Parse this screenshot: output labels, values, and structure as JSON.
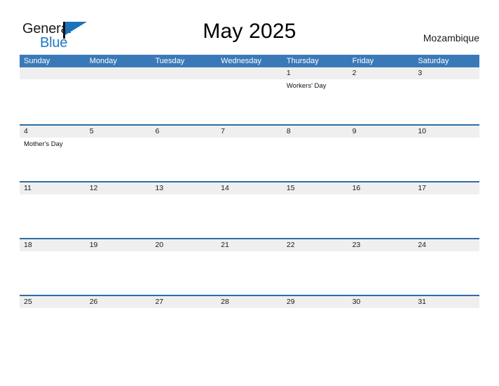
{
  "brand": {
    "name_part1": "General",
    "name_part2": "Blue",
    "flag_icon": "blue-flag-icon"
  },
  "header": {
    "title": "May 2025",
    "country": "Mozambique"
  },
  "calendar": {
    "weekdays": [
      "Sunday",
      "Monday",
      "Tuesday",
      "Wednesday",
      "Thursday",
      "Friday",
      "Saturday"
    ],
    "weeks": [
      {
        "days": [
          {
            "num": "",
            "events": []
          },
          {
            "num": "",
            "events": []
          },
          {
            "num": "",
            "events": []
          },
          {
            "num": "",
            "events": []
          },
          {
            "num": "1",
            "events": [
              "Workers' Day"
            ]
          },
          {
            "num": "2",
            "events": []
          },
          {
            "num": "3",
            "events": []
          }
        ]
      },
      {
        "days": [
          {
            "num": "4",
            "events": [
              "Mother's Day"
            ]
          },
          {
            "num": "5",
            "events": []
          },
          {
            "num": "6",
            "events": []
          },
          {
            "num": "7",
            "events": []
          },
          {
            "num": "8",
            "events": []
          },
          {
            "num": "9",
            "events": []
          },
          {
            "num": "10",
            "events": []
          }
        ]
      },
      {
        "days": [
          {
            "num": "11",
            "events": []
          },
          {
            "num": "12",
            "events": []
          },
          {
            "num": "13",
            "events": []
          },
          {
            "num": "14",
            "events": []
          },
          {
            "num": "15",
            "events": []
          },
          {
            "num": "16",
            "events": []
          },
          {
            "num": "17",
            "events": []
          }
        ]
      },
      {
        "days": [
          {
            "num": "18",
            "events": []
          },
          {
            "num": "19",
            "events": []
          },
          {
            "num": "20",
            "events": []
          },
          {
            "num": "21",
            "events": []
          },
          {
            "num": "22",
            "events": []
          },
          {
            "num": "23",
            "events": []
          },
          {
            "num": "24",
            "events": []
          }
        ]
      },
      {
        "days": [
          {
            "num": "25",
            "events": []
          },
          {
            "num": "26",
            "events": []
          },
          {
            "num": "27",
            "events": []
          },
          {
            "num": "28",
            "events": []
          },
          {
            "num": "29",
            "events": []
          },
          {
            "num": "30",
            "events": []
          },
          {
            "num": "31",
            "events": []
          }
        ]
      }
    ]
  },
  "colors": {
    "header_blue": "#3a79b8",
    "row_divider_blue": "#2e6da4",
    "row_band_gray": "#efefef",
    "brand_blue": "#1f77c4",
    "logo_flag_blue": "#1a72ba"
  }
}
